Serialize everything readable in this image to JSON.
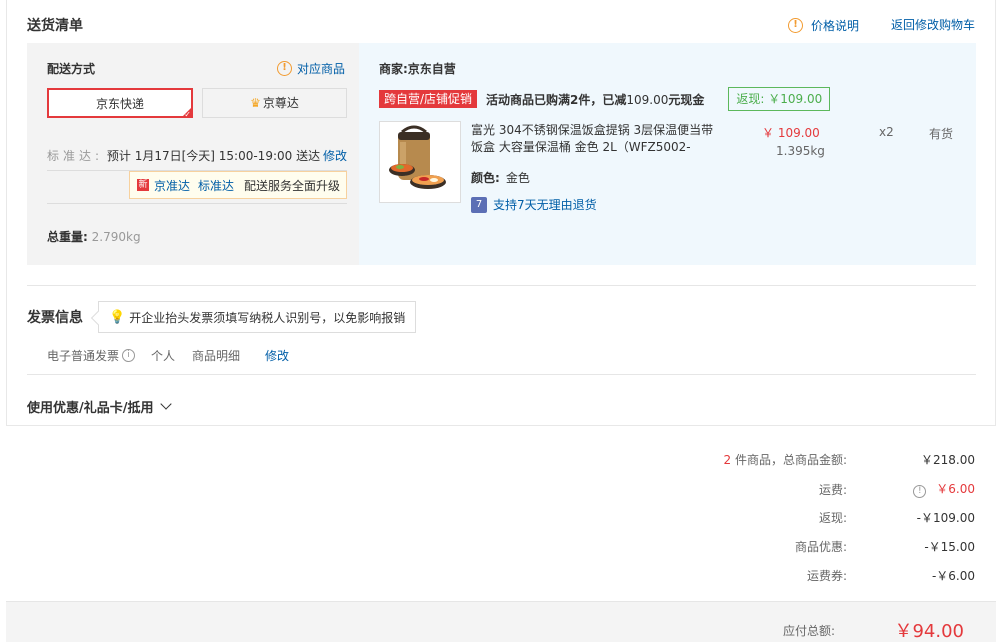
{
  "header": {
    "title": "送货清单",
    "price_note": "价格说明",
    "back_to_cart": "返回修改购物车"
  },
  "shipping": {
    "method_label": "配送方式",
    "match_goods": "对应商品",
    "options": [
      {
        "label": "京东快递",
        "selected": true
      },
      {
        "label": "京尊达",
        "selected": false
      }
    ],
    "standard_label": "标准达:",
    "standard_text": "预计 1月17日[今天] 15:00-19:00 送达",
    "modify": "修改",
    "upgrade_badge": "新",
    "upgrade_a": "京准达",
    "upgrade_b": "标准达",
    "upgrade_c": "配送服务全面升级",
    "weight_label": "总重量:",
    "weight_value": "2.790kg"
  },
  "merchant": {
    "label": "商家:京东自营",
    "promo_tag": "跨自营/店铺促销",
    "promo_text_a": "活动商品已购满2件，已减",
    "promo_amount": "109.00",
    "promo_text_b": "元现金",
    "rebate": "返现: ￥109.00"
  },
  "product": {
    "name": "富光 304不锈钢保温饭盒提锅 3层保温便当带饭盒 大容量保温桶 金色 2L（WFZ5002-",
    "color_label": "颜色:",
    "color_value": "金色",
    "return_badge": "7",
    "return_text": "支持7天无理由退货",
    "price": "￥ 109.00",
    "weight": "1.395kg",
    "qty": "x2",
    "stock": "有货"
  },
  "invoice": {
    "title": "发票信息",
    "tip": "开企业抬头发票须填写纳税人识别号，以免影响报销",
    "type": "电子普通发票",
    "info_icon": "i",
    "person": "个人",
    "detail": "商品明细",
    "modify": "修改"
  },
  "coupon": {
    "label": "使用优惠/礼品卡/抵用"
  },
  "summary": {
    "count": "2",
    "count_label": "件商品，总商品金额:",
    "goods_amount": "￥218.00",
    "freight_label": "运费:",
    "freight_value": "￥6.00",
    "rebate_label": "返现:",
    "rebate_value": "-￥109.00",
    "discount_label": "商品优惠:",
    "discount_value": "-￥15.00",
    "freight_coupon_label": "运费券:",
    "freight_coupon_value": "-￥6.00",
    "total_label": "应付总额:",
    "total_value": "￥94.00"
  },
  "colors": {
    "accent_red": "#e4393c",
    "link_blue": "#005ea7",
    "rebate_green": "#4cae4c",
    "warn_orange": "#f29b30"
  }
}
